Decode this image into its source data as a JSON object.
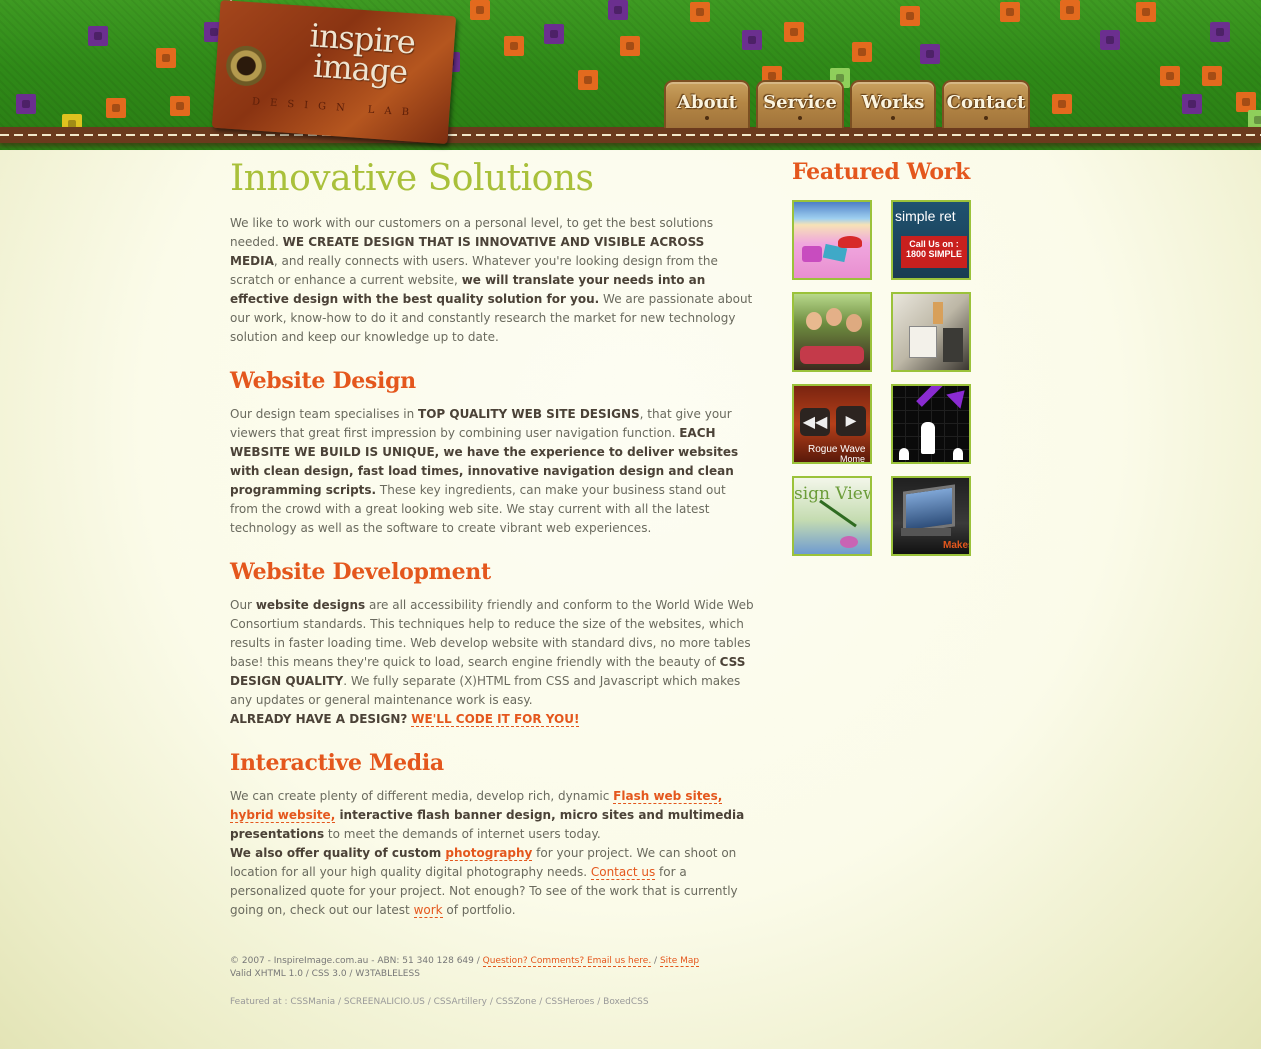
{
  "brand": {
    "name": "inspire image",
    "sub": "DESIGN LAB"
  },
  "nav": [
    {
      "label": "About"
    },
    {
      "label": "Service"
    },
    {
      "label": "Works"
    },
    {
      "label": "Contact"
    }
  ],
  "intro": {
    "title": "Innovative Solutions",
    "p1": "We like to work with our customers on a personal level, to get the best solutions needed. ",
    "p1_b1": "WE CREATE DESIGN THAT IS INNOVATIVE AND VISIBLE ACROSS MEDIA",
    "p1_t2": ", and really connects with users. Whatever you're looking design from the scratch or enhance a current website, ",
    "p1_b2": "we will translate your needs into an effective design with the best quality solution for you.",
    "p1_t3": " We are passionate about our work, know-how to do it and constantly research the market for new technology solution and keep our knowledge up to date."
  },
  "website_design": {
    "heading": "Website Design",
    "t1": "Our design team specialises in ",
    "b1": "TOP QUALITY WEB SITE DESIGNS",
    "t2": ", that give your viewers that great first impression by combining user navigation function. ",
    "b2": "EACH WEBSITE WE BUILD IS UNIQUE, we have the experience to deliver websites with clean design, fast load times, innovative navigation design and clean programming scripts.",
    "t3": " These key ingredients, can make your business stand out from the crowd with a great looking web site. We stay current with all the latest technology as well as the software to create vibrant web experiences."
  },
  "website_development": {
    "heading": "Website Development",
    "t1": "Our ",
    "b1": "website designs",
    "t2": " are all accessibility friendly and conform to the World Wide Web Consortium standards. This techniques help to reduce the size of the websites, which results in faster loading time. Web develop website with standard divs, no more tables base! this means they're quick to load, search engine friendly with the beauty of ",
    "b2": "CSS DESIGN QUALITY",
    "t3": ". We fully separate (X)HTML from CSS and Javascript which makes any updates or general maintenance work is easy.",
    "b3": "ALREADY HAVE A DESIGN?",
    "link": "WE'LL CODE IT FOR YOU!"
  },
  "interactive_media": {
    "heading": "Interactive Media",
    "t1": "We can create plenty of different media, develop rich, dynamic ",
    "l1": "Flash web sites, hybrid website,",
    "b1": " interactive flash banner design, micro sites and multimedia presentations",
    "t2": " to meet the demands of internet users today.",
    "b2": "We also offer quality of custom ",
    "l2": "photography",
    "t3": " for your project. We can shoot on location for all your high quality digital photography needs. ",
    "l3": "Contact us",
    "t4": " for a personalized quote for your project. Not enough? To see of the work that is currently going on, check out our latest ",
    "l4": "work",
    "t5": " of portfolio."
  },
  "featured": {
    "heading": "Featured Work",
    "thumbs": [
      {
        "name": "handbags"
      },
      {
        "name": "simple retail",
        "text1": "simple ret",
        "text2": "Call Us on : 1800 SIMPLE"
      },
      {
        "name": "three women"
      },
      {
        "name": "furniture"
      },
      {
        "name": "rogue wave",
        "text1": "Rogue Wave",
        "text2": "Mome"
      },
      {
        "name": "growth arrow"
      },
      {
        "name": "design view",
        "text1": "sign View"
      },
      {
        "name": "touch screen",
        "text1": "Makes"
      }
    ]
  },
  "footer": {
    "line1": "© 2007 - InspireImage.com.au - ABN: 51 340 128 649 / ",
    "email_link": "Question? Comments? Email us here.",
    "sep": " / ",
    "sitemap_link": "Site Map",
    "line2": "Valid XHTML 1.0 / CSS 3.0 / W3TABLELESS",
    "featured_prefix": "Featured at : ",
    "featured_sites": [
      "CSSMania",
      "SCREENALICIO.US",
      "CSSArtillery",
      "CSSZone",
      "CSSHeroes",
      "BoxedCSS"
    ]
  },
  "colors": {
    "accent": "#e4571d",
    "title_green": "#a9c03a",
    "thumb_border": "#9bc23a",
    "header_green": "#2f8a18"
  }
}
